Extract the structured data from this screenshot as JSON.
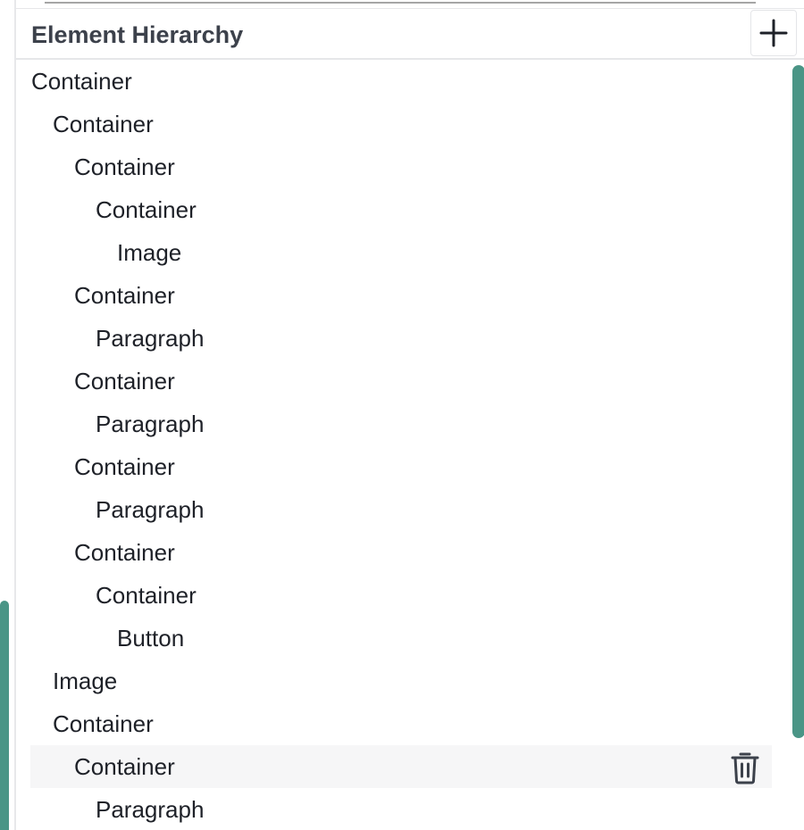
{
  "panel": {
    "title": "Element Hierarchy",
    "add_icon": "plus-icon"
  },
  "tree": {
    "items": [
      {
        "label": "Container",
        "depth": 0
      },
      {
        "label": "Container",
        "depth": 1
      },
      {
        "label": "Container",
        "depth": 2
      },
      {
        "label": "Container",
        "depth": 3
      },
      {
        "label": "Image",
        "depth": 4
      },
      {
        "label": "Container",
        "depth": 2
      },
      {
        "label": "Paragraph",
        "depth": 3
      },
      {
        "label": "Container",
        "depth": 2
      },
      {
        "label": "Paragraph",
        "depth": 3
      },
      {
        "label": "Container",
        "depth": 2
      },
      {
        "label": "Paragraph",
        "depth": 3
      },
      {
        "label": "Container",
        "depth": 2
      },
      {
        "label": "Container",
        "depth": 3
      },
      {
        "label": "Button",
        "depth": 4
      },
      {
        "label": "Image",
        "depth": 1
      },
      {
        "label": "Container",
        "depth": 1
      },
      {
        "label": "Container",
        "depth": 2,
        "selected": true,
        "action_icon": "trash-icon"
      },
      {
        "label": "Paragraph",
        "depth": 3
      }
    ]
  },
  "colors": {
    "accent": "#4a9586",
    "title_text": "#3c414b",
    "item_text": "#1e2128",
    "selected_row": "#f6f6f7",
    "border": "#e6e7e9"
  }
}
